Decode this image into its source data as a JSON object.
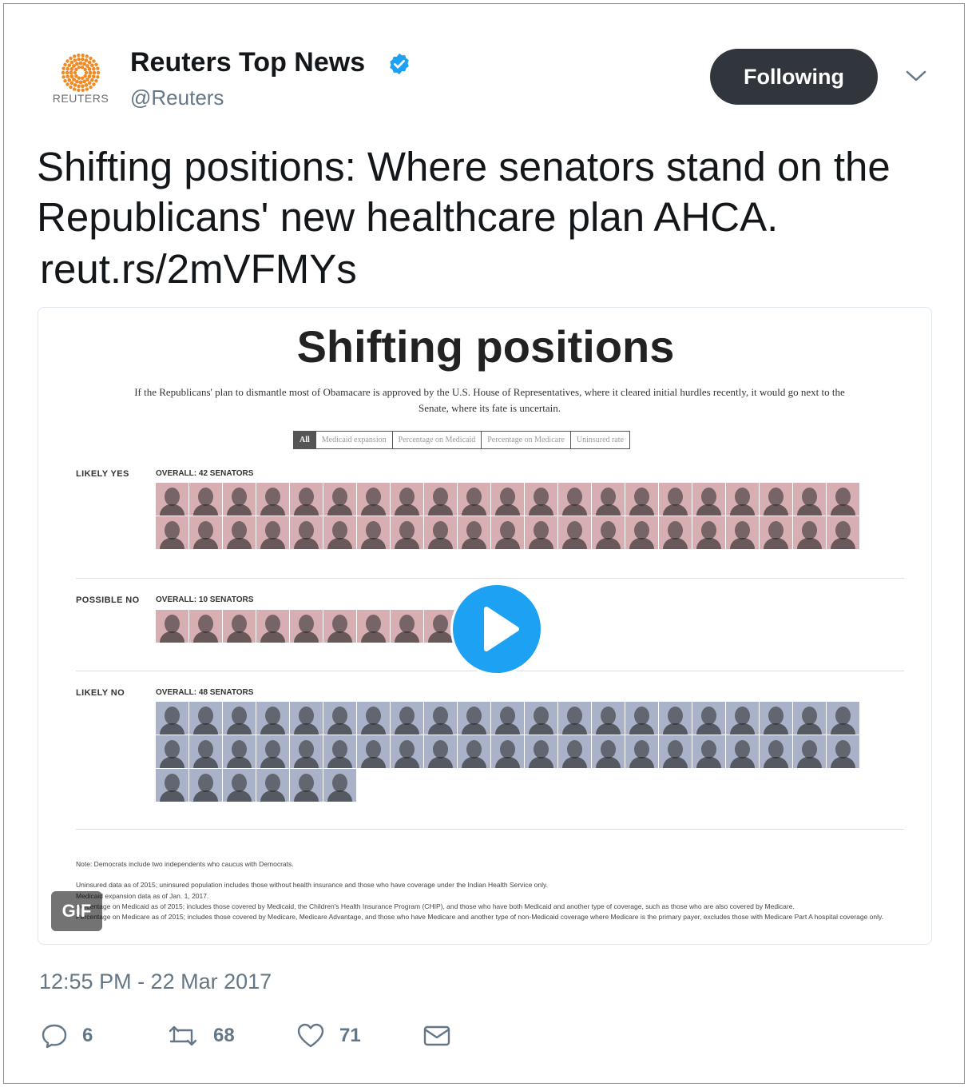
{
  "account": {
    "name": "Reuters Top News",
    "handle": "@Reuters",
    "logo_text": "REUTERS",
    "verified": true,
    "follow_label": "Following"
  },
  "tweet": {
    "text": "Shifting positions: Where senators stand on the Republicans' new healthcare plan AHCA.",
    "link": "reut.rs/2mVFMYs",
    "timestamp": "12:55 PM - 22 Mar 2017"
  },
  "media": {
    "badge": "GIF",
    "graphic": {
      "title": "Shifting positions",
      "subtitle": "If the Republicans' plan to dismantle most of Obamacare is approved by the U.S. House of Representatives, where it cleared initial hurdles recently, it would go next to the Senate, where its fate is uncertain.",
      "tabs": [
        "All",
        "Medicaid expansion",
        "Percentage on Medicaid",
        "Percentage on Medicare",
        "Uninsured rate"
      ],
      "active_tab": "All",
      "sections": [
        {
          "label": "LIKELY YES",
          "overall": "OVERALL: 42 SENATORS",
          "count": 42,
          "tone": "yes"
        },
        {
          "label": "POSSIBLE NO",
          "overall": "OVERALL: 10 SENATORS",
          "count": 10,
          "tone": "yes"
        },
        {
          "label": "LIKELY NO",
          "overall": "OVERALL: 48 SENATORS",
          "count": 48,
          "tone": "no"
        }
      ],
      "notes": [
        "Note: Democrats include two independents who caucus with Democrats.",
        "Uninsured data as of 2015; uninsured population includes those without health insurance and those who have coverage under the Indian Health Service only.",
        "Medicaid expansion data as of Jan. 1, 2017.",
        "Percentage on Medicaid as of 2015; includes those covered by Medicaid, the Children's Health Insurance Program (CHIP), and those who have both Medicaid and another type of coverage, such as those who are also covered by Medicare.",
        "Percentage on Medicare as of 2015; includes those covered by Medicare, Medicare Advantage, and those who have Medicare and another type of non-Medicaid coverage where Medicare is the primary payer, excludes those with Medicare Part A hospital coverage only."
      ]
    }
  },
  "actions": {
    "replies": "6",
    "retweets": "68",
    "likes": "71"
  },
  "colors": {
    "follow_bg": "#31363c",
    "verified": "#1da1f2",
    "play": "#1da1f2",
    "likely_yes_tint": "#d7aeb2",
    "likely_no_tint": "#a9b2c8"
  }
}
